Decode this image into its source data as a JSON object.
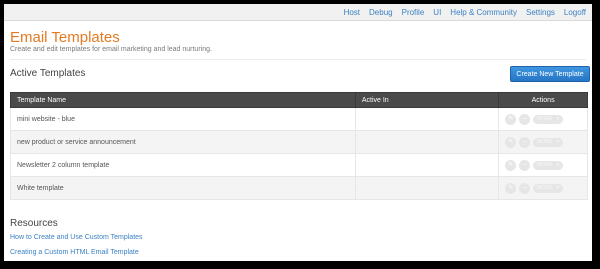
{
  "nav": [
    "Host",
    "Debug",
    "Profile",
    "UI",
    "Help & Community",
    "Settings",
    "Logoff"
  ],
  "page": {
    "title": "Email Templates",
    "subtitle": "Create and edit templates for email marketing and lead nurturing."
  },
  "active": {
    "title": "Active Templates",
    "create_label": "Create New Template"
  },
  "table": {
    "headers": [
      "Template Name",
      "Active In",
      "Actions"
    ],
    "rows": [
      {
        "name": "mini website - blue",
        "active_in": ""
      },
      {
        "name": "new product or service announcement",
        "active_in": ""
      },
      {
        "name": "Newsletter 2 column template",
        "active_in": ""
      },
      {
        "name": "White template",
        "active_in": ""
      }
    ],
    "more_label": "MORE"
  },
  "resources": {
    "title": "Resources",
    "links": [
      "How to Create and Use Custom Templates",
      "Creating a Custom HTML Email Template"
    ]
  }
}
